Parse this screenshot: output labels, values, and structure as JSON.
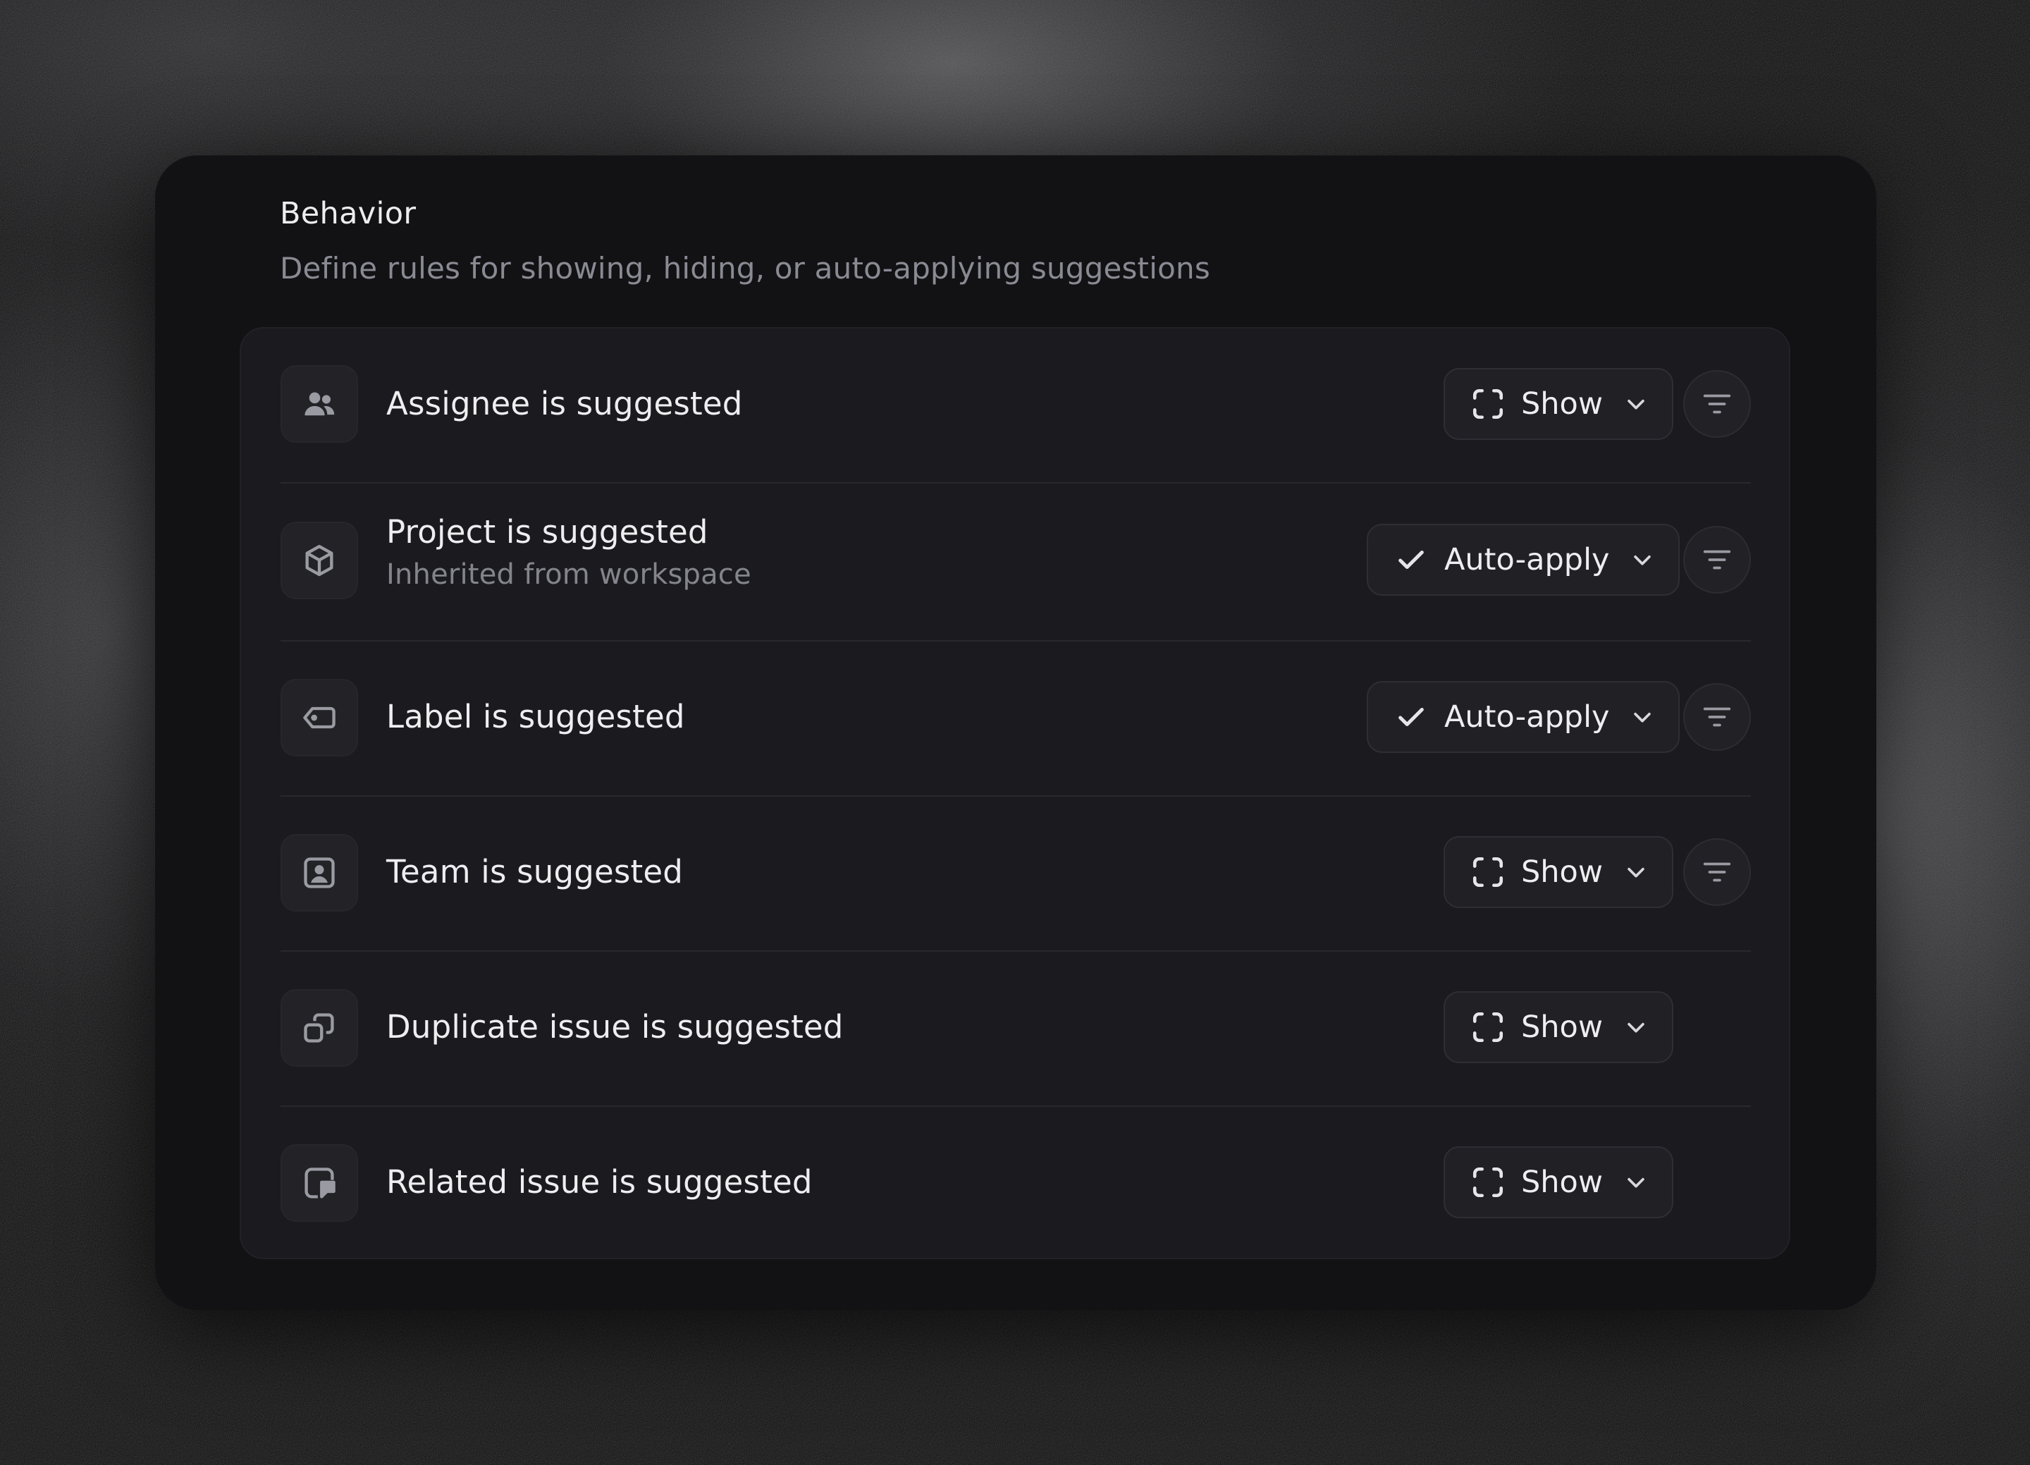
{
  "header": {
    "title": "Behavior",
    "subtitle": "Define rules for showing, hiding, or auto-applying suggestions"
  },
  "rows": [
    {
      "label": "Assignee is suggested",
      "sublabel": "",
      "icon": "users-icon",
      "mode": "Show",
      "mode_icon": "dashed-square-icon",
      "has_filter": true
    },
    {
      "label": "Project is suggested",
      "sublabel": "Inherited from workspace",
      "icon": "box-icon",
      "mode": "Auto-apply",
      "mode_icon": "check-icon",
      "has_filter": true
    },
    {
      "label": "Label is suggested",
      "sublabel": "",
      "icon": "tag-icon",
      "mode": "Auto-apply",
      "mode_icon": "check-icon",
      "has_filter": true
    },
    {
      "label": "Team is suggested",
      "sublabel": "",
      "icon": "team-badge-icon",
      "mode": "Show",
      "mode_icon": "dashed-square-icon",
      "has_filter": true
    },
    {
      "label": "Duplicate issue is suggested",
      "sublabel": "",
      "icon": "duplicate-icon",
      "mode": "Show",
      "mode_icon": "dashed-square-icon",
      "has_filter": false
    },
    {
      "label": "Related issue is suggested",
      "sublabel": "",
      "icon": "related-issue-icon",
      "mode": "Show",
      "mode_icon": "dashed-square-icon",
      "has_filter": false
    }
  ],
  "colors": {
    "panel_bg": "#121215",
    "card_bg": "#1B1B1F",
    "text_primary": "#EEEEF1",
    "text_secondary": "#8A8A93",
    "icon_gray": "#9A9AA2"
  }
}
